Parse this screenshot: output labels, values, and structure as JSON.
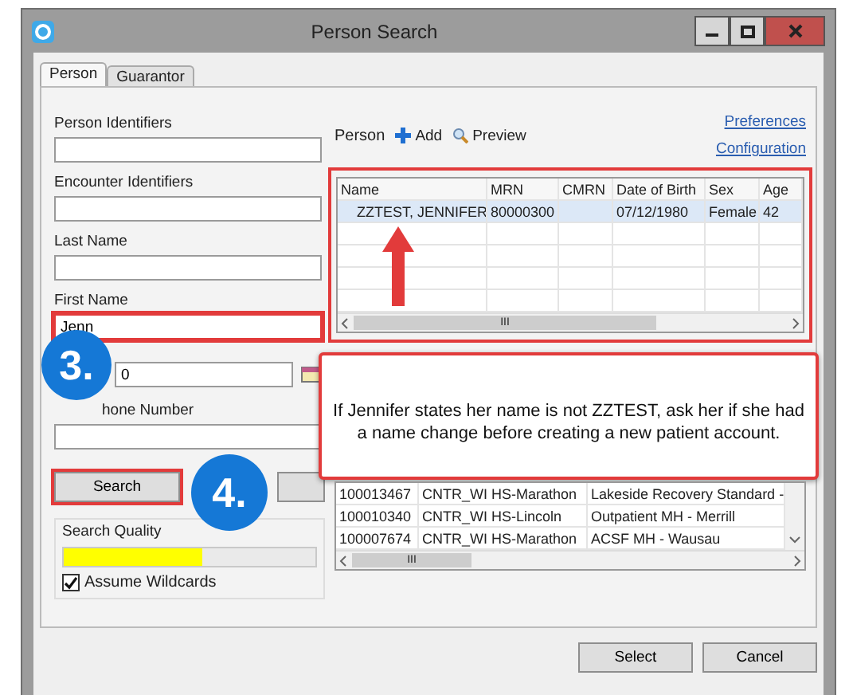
{
  "window": {
    "title": "Person Search"
  },
  "tabs": [
    {
      "label": "Person",
      "selected": true
    },
    {
      "label": "Guarantor",
      "selected": false
    }
  ],
  "form": {
    "fields": [
      {
        "label": "Person Identifiers",
        "highlighted": false
      },
      {
        "label": "Encounter Identifiers",
        "highlighted": false
      },
      {
        "label": "Last Name",
        "highlighted": false
      },
      {
        "label": "First Name",
        "value": "Jenn",
        "highlighted": true
      }
    ],
    "date_field": {
      "value": "0"
    },
    "phone_field": {
      "label": "hone Number"
    },
    "buttons": [
      {
        "kind": "search",
        "label": "Search",
        "highlighted": true
      },
      {
        "kind": "blank",
        "highlighted": false
      }
    ],
    "search_quality": {
      "label": "Search Quality",
      "level": 0.55
    },
    "assume_wildcards": {
      "label": "Assume Wildcards",
      "checked": true
    }
  },
  "toolbar": {
    "label": "Person",
    "actions": [
      {
        "label": "Add",
        "kind": "add"
      },
      {
        "label": "Preview",
        "kind": "preview"
      }
    ],
    "links": [
      "Preferences",
      "Configuration"
    ]
  },
  "results": {
    "columns": [
      "Name",
      "MRN",
      "CMRN",
      "Date of Birth",
      "Sex",
      "Age"
    ],
    "rows": [
      {
        "cells": [
          "ZZTEST, JENNIFER",
          "80000300",
          null,
          "07/12/1980",
          "Female",
          "42"
        ],
        "selected": true
      }
    ],
    "scroll_label": "III"
  },
  "encounters": {
    "rows": [
      [
        "100013467",
        "CNTR_WI HS-Marathon",
        "Lakeside Recovery Standard -"
      ],
      [
        "100010340",
        "CNTR_WI HS-Lincoln",
        "Outpatient MH - Merrill"
      ],
      [
        "100007674",
        "CNTR_WI HS-Marathon",
        "ACSF MH - Wausau"
      ]
    ],
    "scroll_label": "III"
  },
  "callout": {
    "text": "If Jennifer states her name is not ZZTEST, ask her if she had a name change before creating a new patient account."
  },
  "steps": [
    "3.",
    "4."
  ],
  "footer": {
    "buttons": [
      "Select",
      "Cancel"
    ]
  }
}
